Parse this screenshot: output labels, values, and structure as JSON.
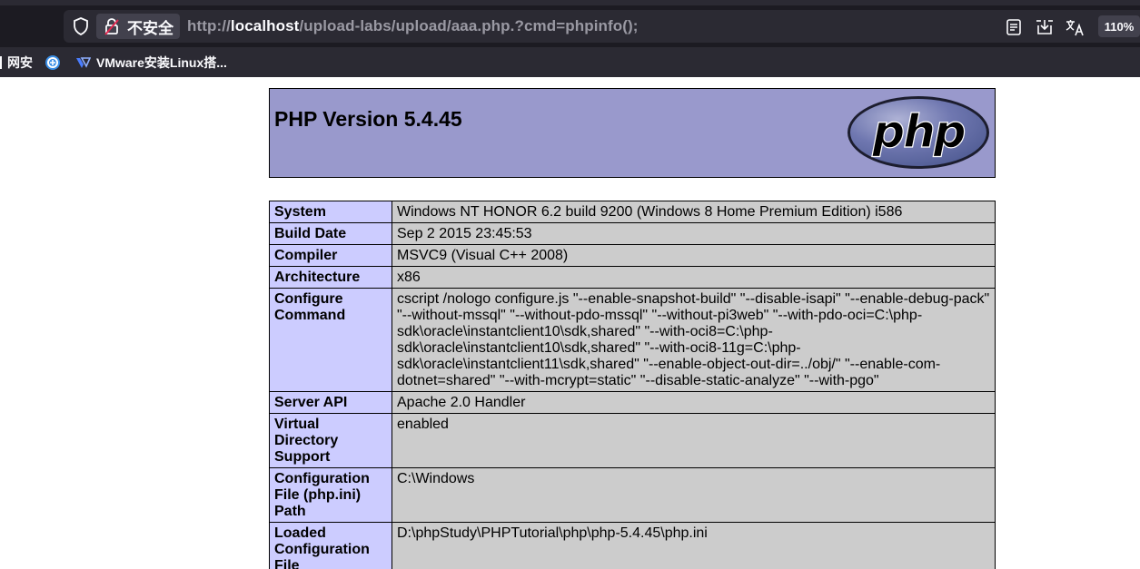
{
  "browser": {
    "security_label": "不安全",
    "url_prefix": "http://",
    "url_host": "localhost",
    "url_path": "/upload-labs/upload/aaa.php.?cmd=phpinfo();",
    "zoom": "110%",
    "bookmarks": [
      {
        "label": "网安",
        "icon": "bookmark-icon"
      },
      {
        "label": "",
        "icon": "globe-icon"
      },
      {
        "label": "VMware安装Linux搭...",
        "icon": "vmware-icon"
      }
    ]
  },
  "phpinfo": {
    "title": "PHP Version 5.4.45",
    "logo_text": "php",
    "rows": [
      {
        "key": "System",
        "value": "Windows NT HONOR 6.2 build 9200 (Windows 8 Home Premium Edition) i586"
      },
      {
        "key": "Build Date",
        "value": "Sep 2 2015 23:45:53"
      },
      {
        "key": "Compiler",
        "value": "MSVC9 (Visual C++ 2008)"
      },
      {
        "key": "Architecture",
        "value": "x86"
      },
      {
        "key": "Configure Command",
        "value": "cscript /nologo configure.js \"--enable-snapshot-build\" \"--disable-isapi\" \"--enable-debug-pack\" \"--without-mssql\" \"--without-pdo-mssql\" \"--without-pi3web\" \"--with-pdo-oci=C:\\php-sdk\\oracle\\instantclient10\\sdk,shared\" \"--with-oci8=C:\\php-sdk\\oracle\\instantclient10\\sdk,shared\" \"--with-oci8-11g=C:\\php-sdk\\oracle\\instantclient11\\sdk,shared\" \"--enable-object-out-dir=../obj/\" \"--enable-com-dotnet=shared\" \"--with-mcrypt=static\" \"--disable-static-analyze\" \"--with-pgo\""
      },
      {
        "key": "Server API",
        "value": "Apache 2.0 Handler"
      },
      {
        "key": "Virtual Directory Support",
        "value": "enabled"
      },
      {
        "key": "Configuration File (php.ini) Path",
        "value": "C:\\Windows"
      },
      {
        "key": "Loaded Configuration File",
        "value": "D:\\phpStudy\\PHPTutorial\\php\\php-5.4.45\\php.ini"
      }
    ]
  },
  "colors": {
    "chrome_dark": "#1c1b22",
    "chrome_mid": "#2b2a33",
    "php_header": "#9999cc",
    "php_key": "#ccccff",
    "php_value": "#cccccc"
  }
}
